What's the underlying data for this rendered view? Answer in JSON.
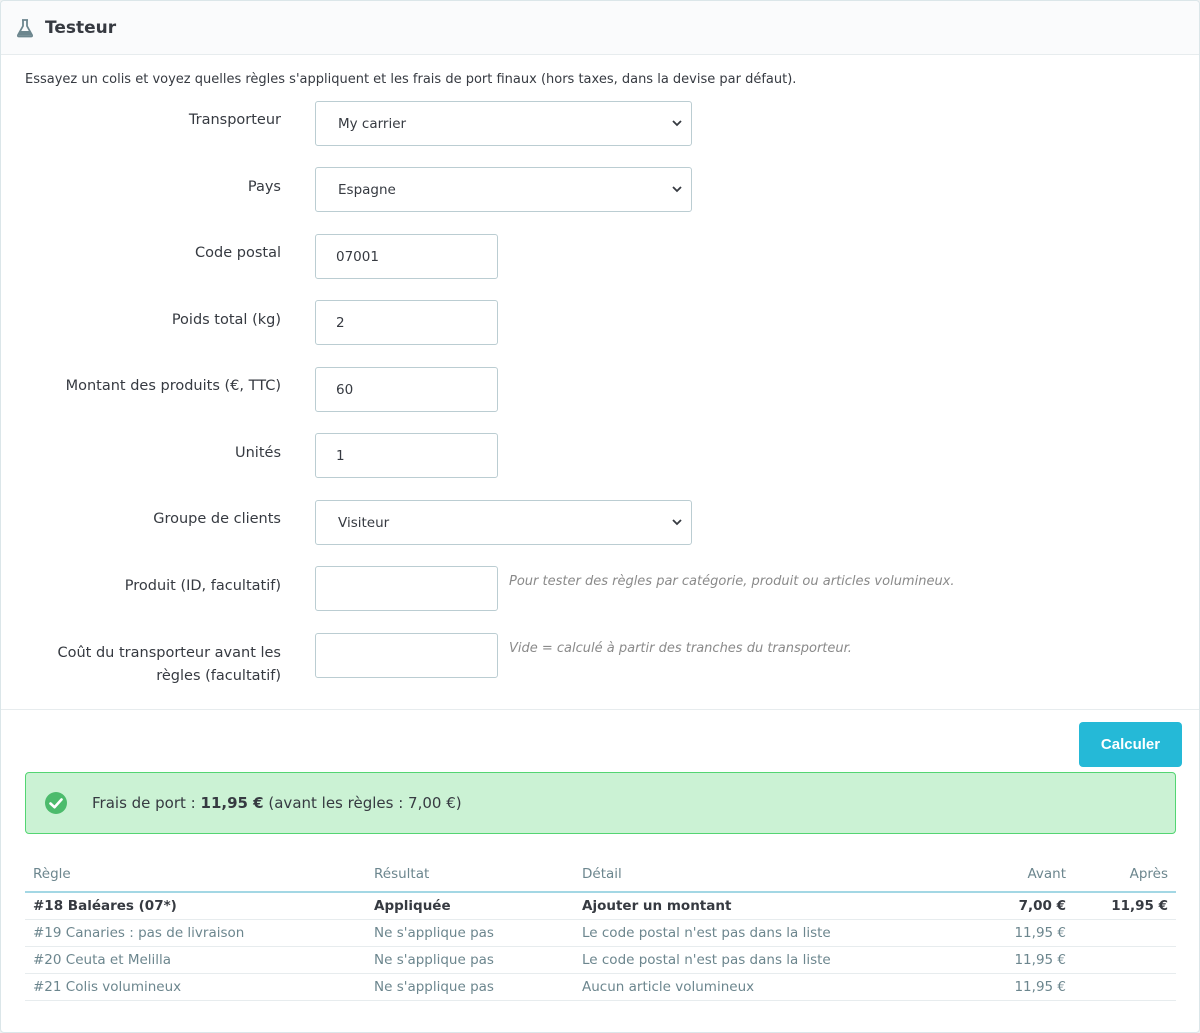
{
  "panel": {
    "title": "Testeur",
    "intro": "Essayez un colis et voyez quelles règles s'appliquent et les frais de port finaux (hors taxes, dans la devise par défaut)."
  },
  "form": {
    "carrier": {
      "label": "Transporteur",
      "value": "My carrier"
    },
    "country": {
      "label": "Pays",
      "value": "Espagne"
    },
    "postcode": {
      "label": "Code postal",
      "value": "07001"
    },
    "weight": {
      "label": "Poids total (kg)",
      "value": "2"
    },
    "amount": {
      "label": "Montant des produits (€, TTC)",
      "value": "60"
    },
    "units": {
      "label": "Unités",
      "value": "1"
    },
    "group": {
      "label": "Groupe de clients",
      "value": "Visiteur"
    },
    "product": {
      "label": "Produit (ID, facultatif)",
      "value": "",
      "help": "Pour tester des règles par catégorie, produit ou articles volumineux."
    },
    "carrier_cost": {
      "label_line1": "Coût du transporteur avant les",
      "label_line2": "règles (facultatif)",
      "value": "",
      "help": "Vide = calculé à partir des tranches du transporteur."
    }
  },
  "actions": {
    "calculate": "Calculer"
  },
  "result": {
    "prefix": "Frais de port : ",
    "total": "11,95 €",
    "suffix": " (avant les règles : 7,00 €)"
  },
  "table": {
    "headers": [
      "Règle",
      "Résultat",
      "Détail",
      "Avant",
      "Après"
    ],
    "rows": [
      {
        "rule": "#18 Baléares (07*)",
        "result": "Appliquée",
        "detail": "Ajouter un montant",
        "before": "7,00 €",
        "after": "11,95 €"
      },
      {
        "rule": "#19 Canaries : pas de livraison",
        "result": "Ne s'applique pas",
        "detail": "Le code postal n'est pas dans la liste",
        "before": "11,95 €",
        "after": ""
      },
      {
        "rule": "#20 Ceuta et Melilla",
        "result": "Ne s'applique pas",
        "detail": "Le code postal n'est pas dans la liste",
        "before": "11,95 €",
        "after": ""
      },
      {
        "rule": "#21 Colis volumineux",
        "result": "Ne s'applique pas",
        "detail": "Aucun article volumineux",
        "before": "11,95 €",
        "after": ""
      }
    ]
  },
  "colors": {
    "accent": "#25b9d7",
    "success_bg": "#cbf2d4",
    "success_border": "#53d572",
    "success_icon": "#4cbb6c"
  },
  "icons": {
    "heading": "flask-icon",
    "alert": "check-circle-icon",
    "select": "chevron-down-icon"
  }
}
